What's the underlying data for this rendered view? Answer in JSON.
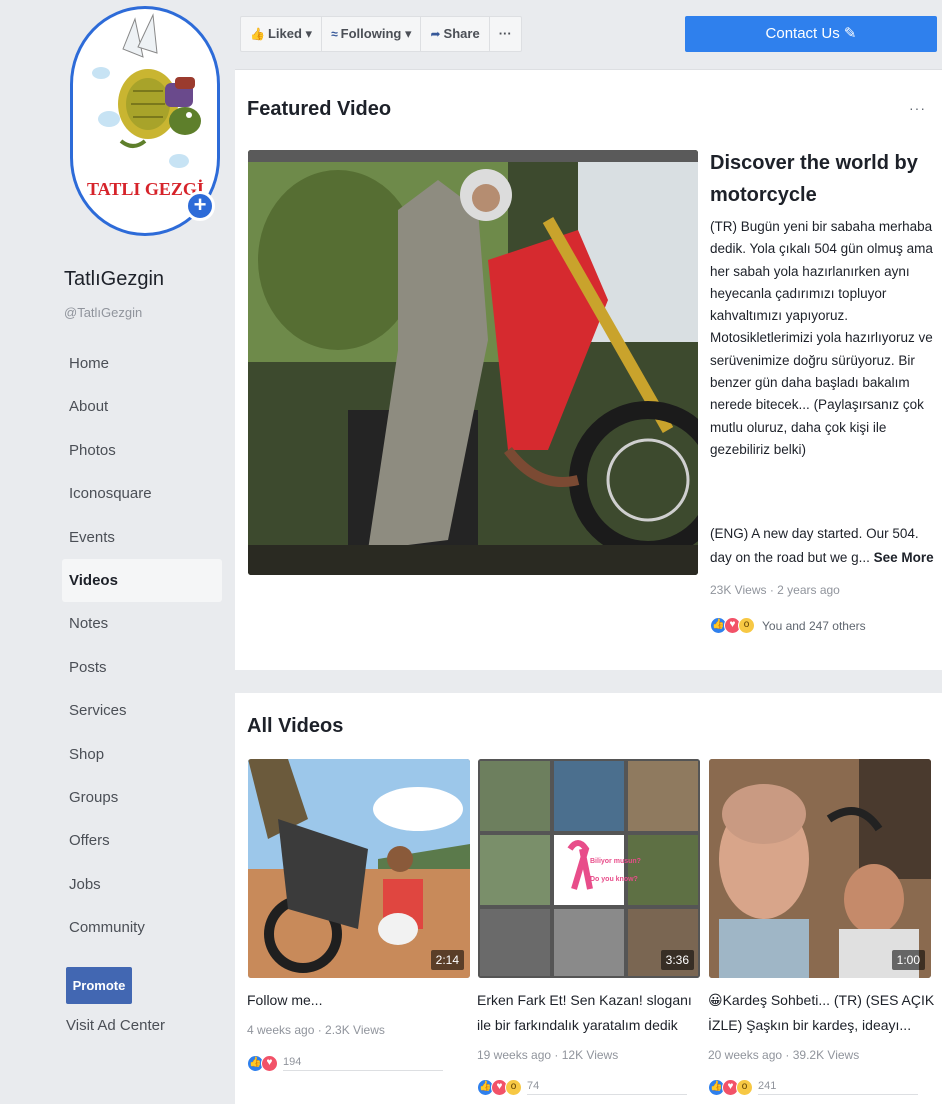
{
  "page": {
    "name": "TatlıGezgin",
    "handle": "@TatlıGezgin",
    "avatar_text": "TATLI GEZGİ",
    "avatar_add_icon": "+"
  },
  "sidebar": {
    "items": [
      {
        "label": "Home",
        "active": false
      },
      {
        "label": "About",
        "active": false
      },
      {
        "label": "Photos",
        "active": false
      },
      {
        "label": "Iconosquare",
        "active": false
      },
      {
        "label": "Events",
        "active": false
      },
      {
        "label": "Videos",
        "active": true
      },
      {
        "label": "Notes",
        "active": false
      },
      {
        "label": "Posts",
        "active": false
      },
      {
        "label": "Services",
        "active": false
      },
      {
        "label": "Shop",
        "active": false
      },
      {
        "label": "Groups",
        "active": false
      },
      {
        "label": "Offers",
        "active": false
      },
      {
        "label": "Jobs",
        "active": false
      },
      {
        "label": "Community",
        "active": false
      }
    ],
    "promote_label": "Promote",
    "visit_ad_center": "Visit Ad Center"
  },
  "toolbar": {
    "liked_label": "Liked",
    "following_label": "Following",
    "share_label": "Share",
    "more_label": "···",
    "dropdown_arrow": "▾",
    "contact_label": "Contact Us"
  },
  "featured": {
    "section_title": "Featured Video",
    "more_dots": "···",
    "title": "Discover the world by motorcycle",
    "description_tr": "(TR) Bugün yeni bir sabaha merhaba dedik. Yola çıkalı 504 gün olmuş ama her sabah yola hazırlanırken aynı heyecanla çadırımızı topluyor kahvaltımızı yapıyoruz. Motosikletlerimizi yola hazırlıyoruz ve serüvenimize doğru sürüyoruz. Bir benzer gün daha başladı bakalım nerede bitecek... (Paylaşırsanız çok mutlu oluruz, daha çok kişi ile gezebiliriz belki)",
    "description_eng": "(ENG) A new day started. Our 504. day on the road but we g...",
    "see_more": "See More",
    "meta": "23K Views · 2 years ago",
    "reactions_text": "You and 247 others"
  },
  "all_videos": {
    "section_title": "All Videos",
    "items": [
      {
        "title": "Follow me...",
        "meta": "4 weeks ago · 2.3K Views",
        "duration": "2:14",
        "reactions_count": "194"
      },
      {
        "title": "Erken Fark Et! Sen Kazan! sloganı ile bir farkındalık yaratalım dedik",
        "meta": "19 weeks ago · 12K Views",
        "duration": "3:36",
        "reactions_count": "74",
        "overlay_text_1": "Biliyor musun?",
        "overlay_text_2": "Do you know?"
      },
      {
        "title": "😀Kardeş Sohbeti... (TR) (SES AÇIK İZLE) Şaşkın bir kardeş, ideayı...",
        "meta": "20 weeks ago · 39.2K Views",
        "duration": "1:00",
        "reactions_count": "241"
      }
    ]
  },
  "colors": {
    "accent_blue": "#2f80ed",
    "brand_blue": "#4267b2",
    "background": "#e9ebee"
  }
}
